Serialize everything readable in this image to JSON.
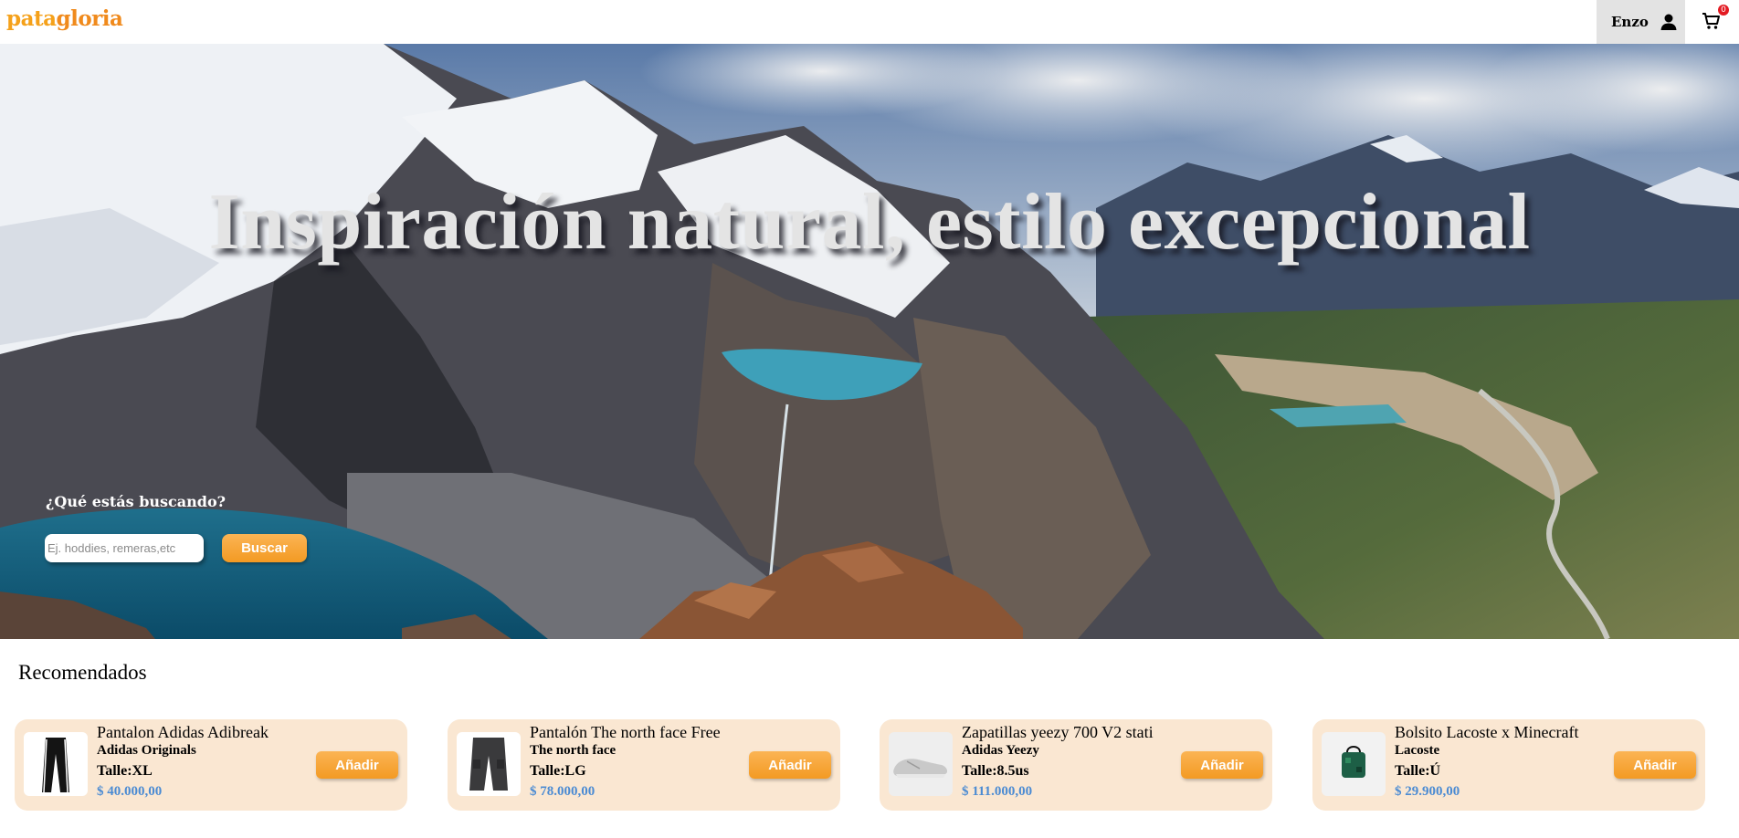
{
  "header": {
    "logo_part1": "pata",
    "logo_part2": "gloria",
    "user_name": "Enzo",
    "cart_count": "0"
  },
  "hero": {
    "title": "Inspiración natural, estilo excepcional",
    "search_label": "¿Qué estás buscando?",
    "search_placeholder": "Ej. hoddies, remeras,etc",
    "search_value": "",
    "search_button": "Buscar"
  },
  "recommended": {
    "title": "Recomendados",
    "products": [
      {
        "name": "Pantalon Adidas Adibreak",
        "brand": "Adidas Originals",
        "size": "Talle:XL",
        "price": "$ 40.000,00",
        "button": "Añadir",
        "icon": "black-pants-icon"
      },
      {
        "name": "Pantalón The north face Free",
        "brand": "The north face",
        "size": "Talle:LG",
        "price": "$ 78.000,00",
        "button": "Añadir",
        "icon": "cargo-pants-icon"
      },
      {
        "name": "Zapatillas yeezy 700 V2 stati",
        "brand": "Adidas Yeezy",
        "size": "Talle:8.5us",
        "price": "$ 111.000,00",
        "button": "Añadir",
        "icon": "sneaker-icon"
      },
      {
        "name": "Bolsito Lacoste x Minecraft",
        "brand": "Lacoste",
        "size": "Talle:Ú",
        "price": "$ 29.900,00",
        "button": "Añadir",
        "icon": "green-bag-icon"
      }
    ]
  },
  "colors": {
    "accent": "#f39a23",
    "card_bg": "#fae7d2",
    "price": "#4b8bd3",
    "badge": "#e31b23"
  }
}
